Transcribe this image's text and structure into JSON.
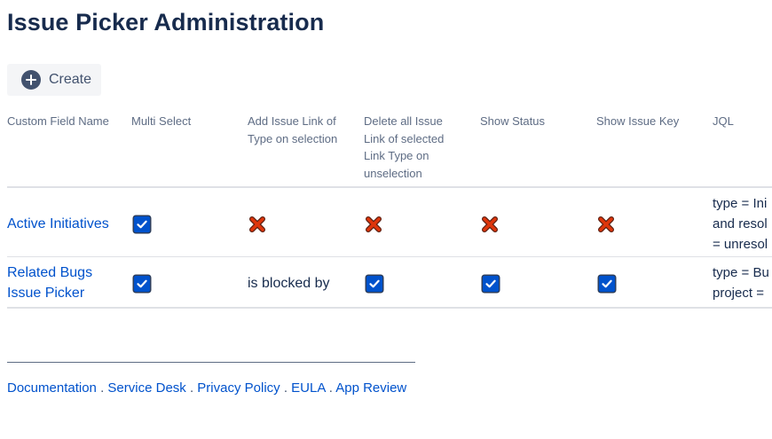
{
  "page": {
    "title": "Issue Picker Administration"
  },
  "toolbar": {
    "create_label": "Create",
    "create_icon": "add-circle-icon"
  },
  "table": {
    "headers": {
      "custom_field_name": "Custom Field Name",
      "multi_select": "Multi Select",
      "add_issue_link": "Add Issue Link of Type on selection",
      "delete_issue_link": "Delete all Issue Link of selected Link Type on unselection",
      "show_status": "Show Status",
      "show_issue_key": "Show Issue Key",
      "jql": "JQL"
    },
    "rows": [
      {
        "name": "Active Initiatives",
        "multi_select": true,
        "add_issue_link": false,
        "delete_issue_link": false,
        "show_status": false,
        "show_issue_key": false,
        "jql_lines": [
          "type = Ini",
          "and resol",
          "= unresol"
        ]
      },
      {
        "name_lines": [
          "Related Bugs",
          "Issue Picker"
        ],
        "multi_select": true,
        "add_issue_link_text": "is blocked by",
        "delete_issue_link": true,
        "show_status": true,
        "show_issue_key": true,
        "jql_lines": [
          "type = Bu",
          "project ="
        ]
      }
    ]
  },
  "footer": {
    "links": [
      "Documentation",
      "Service Desk",
      "Privacy Policy",
      "EULA",
      "App Review"
    ],
    "separator": " . "
  },
  "colors": {
    "link": "#0052cc",
    "heading": "#172b4d",
    "check": "#0052cc",
    "cross": "#de350b"
  }
}
